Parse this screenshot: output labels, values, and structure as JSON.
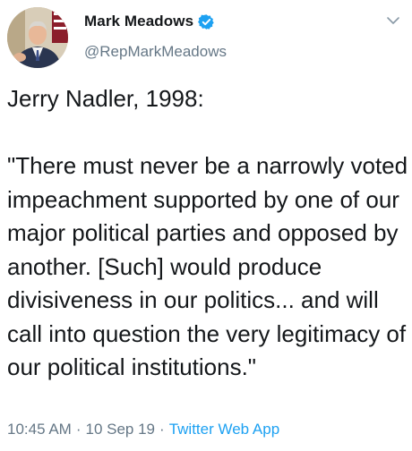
{
  "author": {
    "display_name": "Mark Meadows",
    "handle": "@RepMarkMeadows",
    "verified": true
  },
  "tweet": {
    "text": "Jerry Nadler, 1998:\n\n\"There must never be a narrowly voted impeachment supported by one of our major political parties and opposed by another. [Such] would produce divisiveness in our politics... and will call into question the very legitimacy of our political institutions.\""
  },
  "meta": {
    "time": "10:45 AM",
    "separator": "·",
    "date": "10 Sep 19",
    "source": "Twitter Web App"
  },
  "icons": {
    "verified": "verified-badge-icon",
    "menu": "chevron-down-icon"
  },
  "colors": {
    "accent": "#1da1f2",
    "text": "#14171a",
    "secondary": "#657786"
  }
}
